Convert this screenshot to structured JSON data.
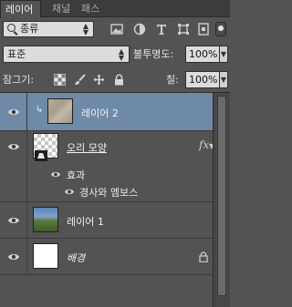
{
  "tabs": [
    {
      "label": "레이어"
    },
    {
      "label": "채널"
    },
    {
      "label": "패스"
    }
  ],
  "filter": {
    "value": "종류"
  },
  "blend": {
    "mode": "표준",
    "opacity_label": "불투명도:",
    "opacity": "100%"
  },
  "lock": {
    "label": "잠그기:",
    "fill_label": "칠:",
    "fill": "100%"
  },
  "layers": [
    {
      "name": "레이어 2"
    },
    {
      "name": "오리 모양",
      "fx": "fx",
      "effects_label": "효과",
      "effect": "경사와 엠보스"
    },
    {
      "name": "레이어 1"
    },
    {
      "name": "배경"
    }
  ],
  "colors": {
    "panel_bg": "#535353",
    "selected_row": "#6e8aa6",
    "tab_bar": "#3c3c3c"
  },
  "icons": [
    "search-icon",
    "image-filter-icon",
    "adjustment-filter-icon",
    "type-filter-icon",
    "shape-filter-icon",
    "smart-object-filter-icon",
    "eye-icon",
    "lock-icon",
    "brush-icon",
    "move-icon",
    "clip-arrow-icon",
    "fx-icon"
  ]
}
